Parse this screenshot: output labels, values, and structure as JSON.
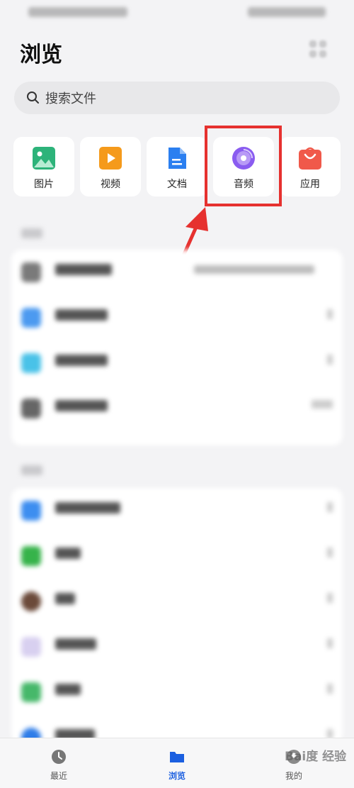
{
  "header": {
    "title": "浏览"
  },
  "search": {
    "placeholder": "搜索文件"
  },
  "categories": [
    {
      "label": "图片",
      "icon": "image-icon",
      "color": "#2db37a"
    },
    {
      "label": "视频",
      "icon": "video-icon",
      "color": "#f59a1b"
    },
    {
      "label": "文档",
      "icon": "document-icon",
      "color": "#2b7ff0"
    },
    {
      "label": "音频",
      "icon": "audio-icon",
      "color": "#8a5cf0"
    },
    {
      "label": "应用",
      "icon": "app-store-icon",
      "color": "#f0594a"
    }
  ],
  "bottom_nav": [
    {
      "label": "最近",
      "icon": "clock-icon"
    },
    {
      "label": "浏览",
      "icon": "folder-icon",
      "active": true
    },
    {
      "label": "我的",
      "icon": "profile-icon"
    }
  ],
  "watermark": {
    "text": "Bai度 经验"
  },
  "colors": {
    "accent": "#1b5fe0",
    "highlight": "#e6312f"
  }
}
